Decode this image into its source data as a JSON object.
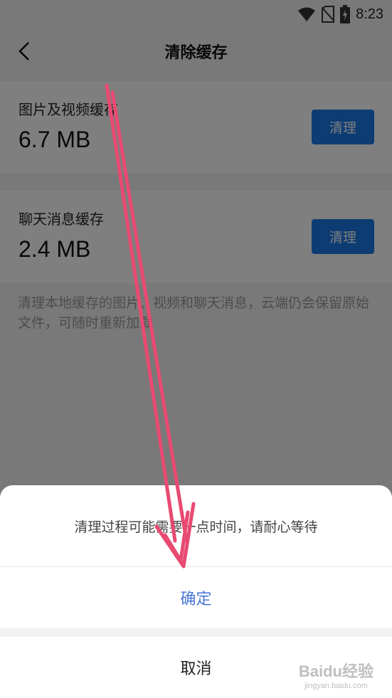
{
  "status_bar": {
    "time": "8:23",
    "icons": [
      "wifi-icon",
      "no-sim-icon",
      "battery-charging-icon"
    ]
  },
  "header": {
    "back_icon": "chevron-left-icon",
    "title": "清除缓存"
  },
  "caches": [
    {
      "label": "图片及视频缓存",
      "size": "6.7 MB",
      "button": "清理"
    },
    {
      "label": "聊天消息缓存",
      "size": "2.4 MB",
      "button": "清理"
    }
  ],
  "hint": "清理本地缓存的图片、视频和聊天消息，云端仍会保留原始文件，可随时重新加载",
  "sheet": {
    "message": "清理过程可能需要一点时间，请耐心等待",
    "confirm": "确定",
    "cancel": "取消"
  },
  "watermark": {
    "logo": "Baidu经验",
    "sub": "jingyan.baidu.com"
  },
  "colors": {
    "accent": "#1a79e6",
    "confirm_text": "#4a76d6",
    "annotation": "#e84a72"
  }
}
